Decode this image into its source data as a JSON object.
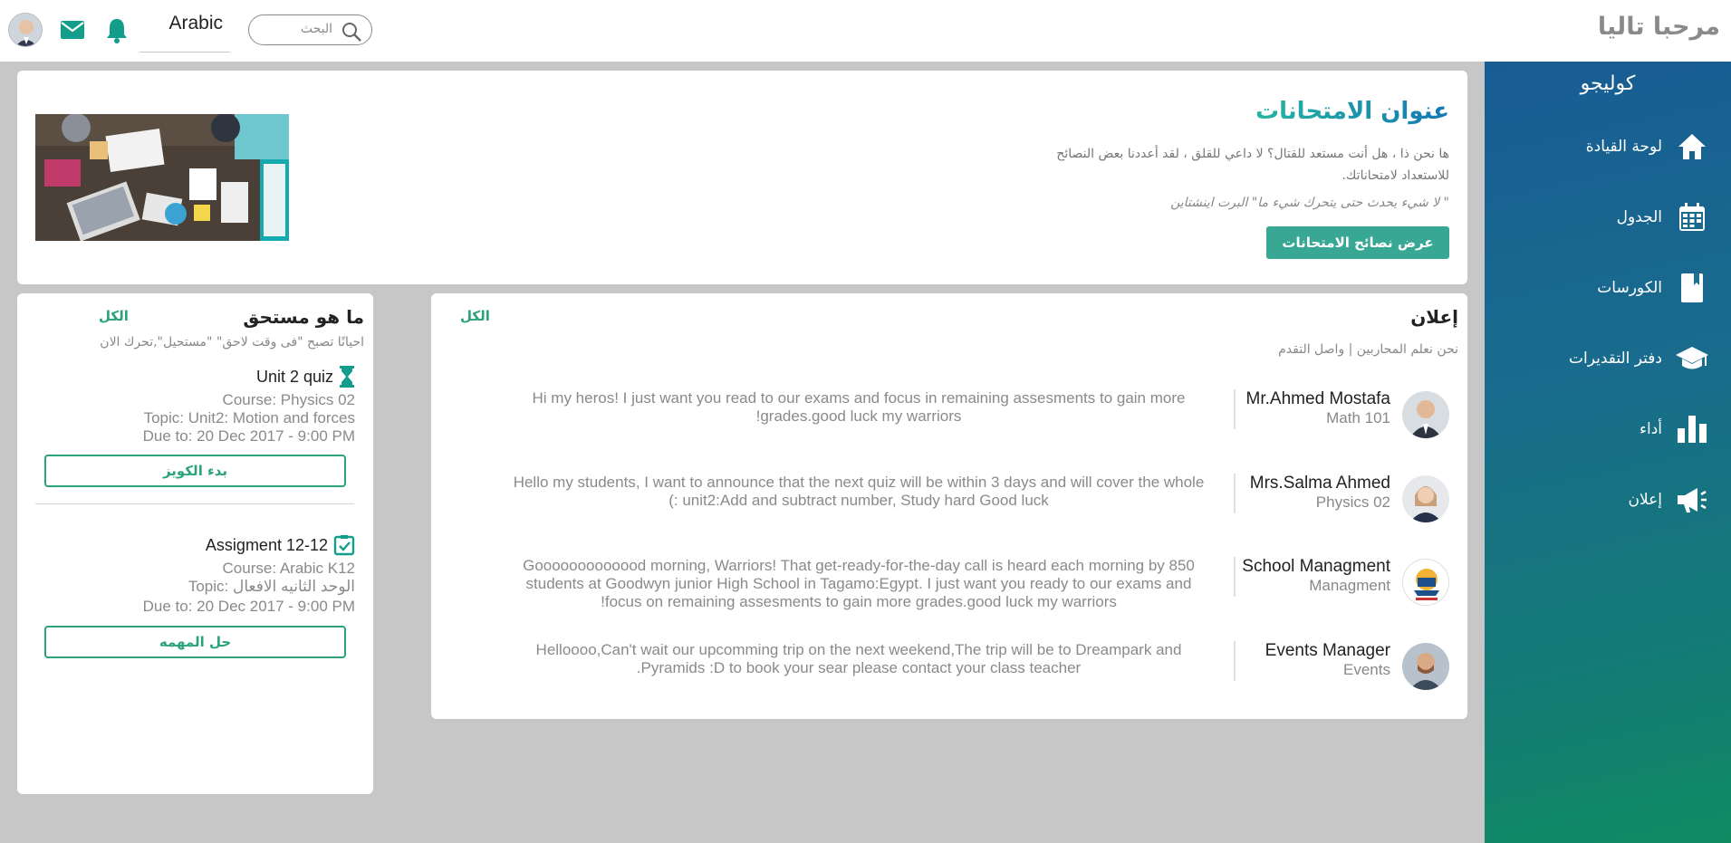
{
  "header": {
    "greeting": "مرحبا تاليا",
    "language": "Arabic",
    "search_placeholder": "البحث",
    "icons": [
      "avatar",
      "mail-icon",
      "bell-icon",
      "search-icon"
    ]
  },
  "sidebar": {
    "brand": "كوليجو",
    "items": [
      {
        "label": "لوحة القيادة",
        "icon": "home-icon"
      },
      {
        "label": "الجدول",
        "icon": "calendar-icon"
      },
      {
        "label": "الكورسات",
        "icon": "book-icon"
      },
      {
        "label": "دفتر التقديرات",
        "icon": "graduation-cap-icon"
      },
      {
        "label": "أداء",
        "icon": "bar-chart-icon"
      },
      {
        "label": "إعلان",
        "icon": "megaphone-icon"
      }
    ]
  },
  "exam": {
    "title": "عنوان الامتحانات",
    "description": "ها نحن ذا ، هل أنت مستعد للقتال؟ لا داعي للقلق ، لقد أعددنا بعض النصائح للاستعداد لامتحاناتك.",
    "quote": "\" لا شيء يحدث حتى يتحرك شيء ما\" البرت اينشتاين",
    "button": "عرض نصائح الامتحانات"
  },
  "announcements": {
    "title": "إعلان",
    "view_all": "الكل",
    "subtitle": "نحن نعلم المحاربين | واصل التقدم",
    "items": [
      {
        "name": "Mr.Ahmed Mostafa",
        "role": "Math 101",
        "message": "Hi my heros! I just want you read to our exams and focus in remaining assesments to gain more grades.good luck my warriors!"
      },
      {
        "name": "Mrs.Salma Ahmed",
        "role": "Physics 02",
        "message": "Hello my students, I want to announce that the next quiz will be within 3 days and will cover the whole unit2:Add and subtract number, Study hard Good luck :)"
      },
      {
        "name": "School Managment",
        "role": "Managment",
        "message": "Gooooooooooood morning,  Warriors! That get-ready-for-the-day call is heard each morning by 850 students at Goodwyn junior High School in Tagamo:Egypt. I just want you ready to our exams and focus on remaining assesments to gain more grades.good luck my warriors!"
      },
      {
        "name": "Events Manager",
        "role": "Events",
        "message": "Helloooo,Can't wait our upcomming trip on the next weekend,The trip will be to Dreampark and Pyramids :D to book your sear please contact your class teacher."
      }
    ]
  },
  "due": {
    "title": "ما هو مستحق",
    "view_all": "الكل",
    "subtitle": "احيانًا تصبح \"فى وقت لاحق\" \"مستحيل\",تحرك الان",
    "items": [
      {
        "title": "Unit 2 quiz",
        "icon": "hourglass-icon",
        "course": "Course: Physics 02",
        "topic": "Topic:   Unit2: Motion and forces",
        "due": "Due to:  20 Dec 2017 - 9:00 PM",
        "button": "بدء الكويز"
      },
      {
        "title": "Assigment 12-12",
        "icon": "assignment-icon",
        "course": "Course: Arabic K12",
        "topic": "Topic:   الوحد الثانيه الافعال",
        "due": "Due to:  20 Dec 2017 - 9:00 PM",
        "button": "حل المهمه"
      }
    ]
  },
  "colors": {
    "accent": "#2aa37a",
    "button_fill": "#38a895",
    "sidebar_top": "#185c94",
    "sidebar_bottom": "#0f8b62",
    "icon_teal": "#139e8c"
  }
}
